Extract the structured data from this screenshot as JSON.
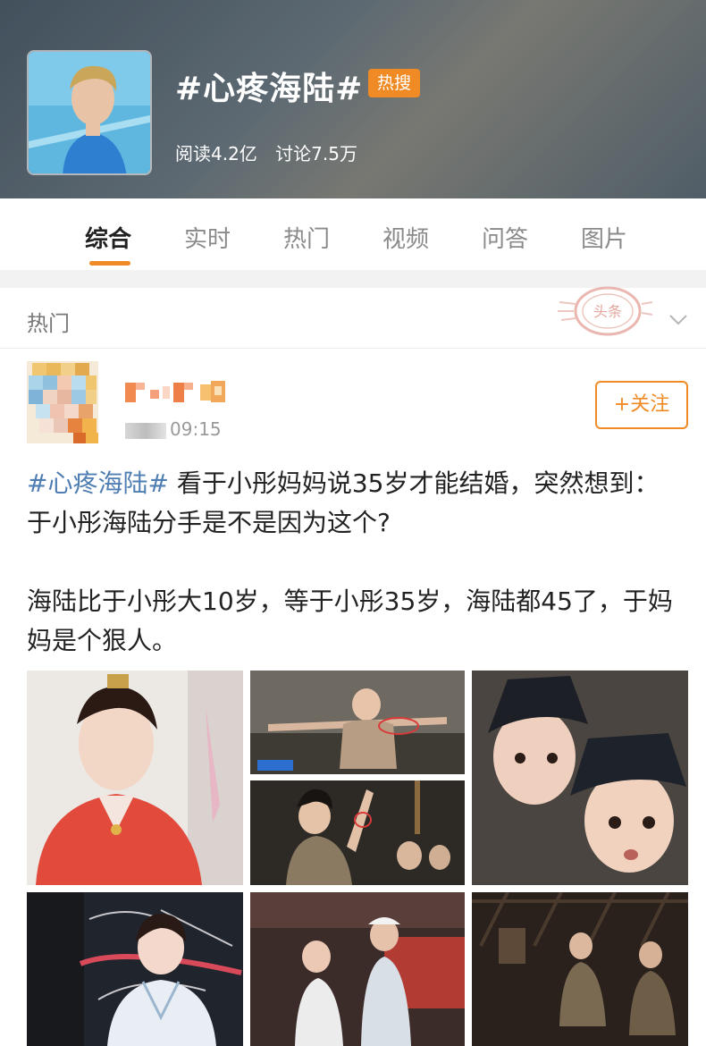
{
  "topic": {
    "title": "#心疼海陆#",
    "badge": "热搜",
    "reads": "阅读4.2亿",
    "discussions": "讨论7.5万"
  },
  "tabs": [
    {
      "label": "综合",
      "active": true
    },
    {
      "label": "实时",
      "active": false
    },
    {
      "label": "热门",
      "active": false
    },
    {
      "label": "视频",
      "active": false
    },
    {
      "label": "问答",
      "active": false
    },
    {
      "label": "图片",
      "active": false
    }
  ],
  "hot_section": {
    "label": "热门",
    "stamp_text": "头条"
  },
  "post": {
    "time": "09:15",
    "follow_label": "+关注",
    "hashtag": "#心疼海陆#",
    "text_line1": " 看于小彤妈妈说35岁才能结婚，突然想到：于小彤海陆分手是不是因为这个?",
    "text_para2": "海陆比于小彤大10岁，等于小彤35岁，海陆都45了，于妈妈是个狠人。"
  },
  "colors": {
    "accent": "#f08a24",
    "link": "#4f7eb3",
    "muted": "#8a8a8a"
  },
  "icons": {
    "chevron": "chevron-down-icon"
  }
}
